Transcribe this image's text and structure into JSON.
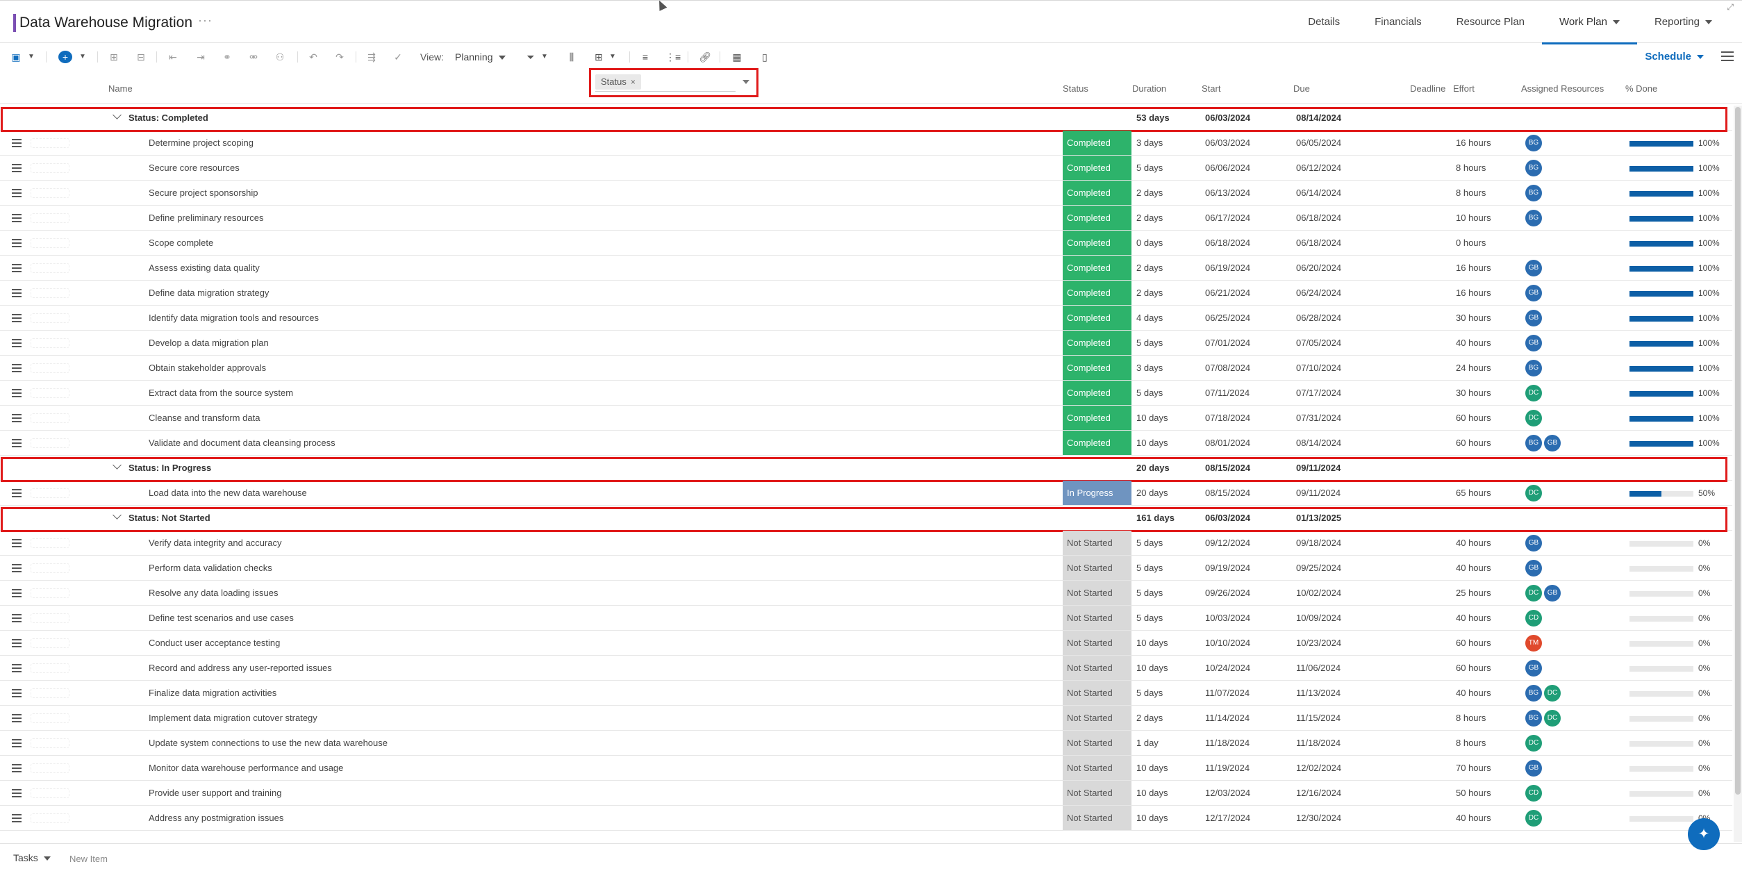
{
  "header": {
    "title": "Data Warehouse Migration",
    "more": "···",
    "tabs": [
      "Details",
      "Financials",
      "Resource Plan",
      "Work Plan",
      "Reporting"
    ],
    "active_tab": "Work Plan"
  },
  "toolbar": {
    "view_label": "View:",
    "view_value": "Planning",
    "schedule_label": "Schedule"
  },
  "groupby": {
    "chip": "Status",
    "remove": "×"
  },
  "columns": {
    "name": "Name",
    "status": "Status",
    "duration": "Duration",
    "start": "Start",
    "due": "Due",
    "deadline": "Deadline",
    "effort": "Effort",
    "assigned": "Assigned Resources",
    "done": "% Done"
  },
  "groups": [
    {
      "label": "Status: Completed",
      "duration": "53 days",
      "start": "06/03/2024",
      "due": "08/14/2024",
      "status_class": "completed",
      "rows": [
        {
          "name": "Determine project scoping",
          "status": "Completed",
          "duration": "3 days",
          "start": "06/03/2024",
          "due": "06/05/2024",
          "effort": "16 hours",
          "resources": [
            "BG"
          ],
          "pct": 100,
          "pct_label": "100%"
        },
        {
          "name": "Secure core resources",
          "status": "Completed",
          "duration": "5 days",
          "start": "06/06/2024",
          "due": "06/12/2024",
          "effort": "8 hours",
          "resources": [
            "BG"
          ],
          "pct": 100,
          "pct_label": "100%"
        },
        {
          "name": "Secure project sponsorship",
          "status": "Completed",
          "duration": "2 days",
          "start": "06/13/2024",
          "due": "06/14/2024",
          "effort": "8 hours",
          "resources": [
            "BG"
          ],
          "pct": 100,
          "pct_label": "100%"
        },
        {
          "name": "Define preliminary resources",
          "status": "Completed",
          "duration": "2 days",
          "start": "06/17/2024",
          "due": "06/18/2024",
          "effort": "10 hours",
          "resources": [
            "BG"
          ],
          "pct": 100,
          "pct_label": "100%"
        },
        {
          "name": "Scope complete",
          "status": "Completed",
          "duration": "0 days",
          "start": "06/18/2024",
          "due": "06/18/2024",
          "effort": "0 hours",
          "resources": [],
          "pct": 100,
          "pct_label": "100%"
        },
        {
          "name": "Assess existing data quality",
          "status": "Completed",
          "duration": "2 days",
          "start": "06/19/2024",
          "due": "06/20/2024",
          "effort": "16 hours",
          "resources": [
            "GB"
          ],
          "pct": 100,
          "pct_label": "100%"
        },
        {
          "name": "Define data migration strategy",
          "status": "Completed",
          "duration": "2 days",
          "start": "06/21/2024",
          "due": "06/24/2024",
          "effort": "16 hours",
          "resources": [
            "GB"
          ],
          "pct": 100,
          "pct_label": "100%"
        },
        {
          "name": "Identify data migration tools and resources",
          "status": "Completed",
          "duration": "4 days",
          "start": "06/25/2024",
          "due": "06/28/2024",
          "effort": "30 hours",
          "resources": [
            "GB"
          ],
          "pct": 100,
          "pct_label": "100%"
        },
        {
          "name": "Develop a data migration plan",
          "status": "Completed",
          "duration": "5 days",
          "start": "07/01/2024",
          "due": "07/05/2024",
          "effort": "40 hours",
          "resources": [
            "GB"
          ],
          "pct": 100,
          "pct_label": "100%"
        },
        {
          "name": "Obtain stakeholder approvals",
          "status": "Completed",
          "duration": "3 days",
          "start": "07/08/2024",
          "due": "07/10/2024",
          "effort": "24 hours",
          "resources": [
            "BG"
          ],
          "pct": 100,
          "pct_label": "100%"
        },
        {
          "name": "Extract data from the source system",
          "status": "Completed",
          "duration": "5 days",
          "start": "07/11/2024",
          "due": "07/17/2024",
          "effort": "30 hours",
          "resources": [
            "DC"
          ],
          "pct": 100,
          "pct_label": "100%"
        },
        {
          "name": "Cleanse and transform data",
          "status": "Completed",
          "duration": "10 days",
          "start": "07/18/2024",
          "due": "07/31/2024",
          "effort": "60 hours",
          "resources": [
            "DC"
          ],
          "pct": 100,
          "pct_label": "100%"
        },
        {
          "name": "Validate and document data cleansing process",
          "status": "Completed",
          "duration": "10 days",
          "start": "08/01/2024",
          "due": "08/14/2024",
          "effort": "60 hours",
          "resources": [
            "BG",
            "GB"
          ],
          "pct": 100,
          "pct_label": "100%"
        }
      ]
    },
    {
      "label": "Status: In Progress",
      "duration": "20 days",
      "start": "08/15/2024",
      "due": "09/11/2024",
      "status_class": "inprogress",
      "rows": [
        {
          "name": "Load data into the new data warehouse",
          "status": "In Progress",
          "duration": "20 days",
          "start": "08/15/2024",
          "due": "09/11/2024",
          "effort": "65 hours",
          "resources": [
            "DC"
          ],
          "pct": 50,
          "pct_label": "50%"
        }
      ]
    },
    {
      "label": "Status: Not Started",
      "duration": "161 days",
      "start": "06/03/2024",
      "due": "01/13/2025",
      "status_class": "notstarted",
      "rows": [
        {
          "name": "Verify data integrity and accuracy",
          "status": "Not Started",
          "duration": "5 days",
          "start": "09/12/2024",
          "due": "09/18/2024",
          "effort": "40 hours",
          "resources": [
            "GB"
          ],
          "pct": 0,
          "pct_label": "0%"
        },
        {
          "name": "Perform data validation checks",
          "status": "Not Started",
          "duration": "5 days",
          "start": "09/19/2024",
          "due": "09/25/2024",
          "effort": "40 hours",
          "resources": [
            "GB"
          ],
          "pct": 0,
          "pct_label": "0%"
        },
        {
          "name": "Resolve any data loading issues",
          "status": "Not Started",
          "duration": "5 days",
          "start": "09/26/2024",
          "due": "10/02/2024",
          "effort": "25 hours",
          "resources": [
            "DC",
            "GB"
          ],
          "pct": 0,
          "pct_label": "0%"
        },
        {
          "name": "Define test scenarios and use cases",
          "status": "Not Started",
          "duration": "5 days",
          "start": "10/03/2024",
          "due": "10/09/2024",
          "effort": "40 hours",
          "resources": [
            "CD"
          ],
          "pct": 0,
          "pct_label": "0%"
        },
        {
          "name": "Conduct user acceptance testing",
          "status": "Not Started",
          "duration": "10 days",
          "start": "10/10/2024",
          "due": "10/23/2024",
          "effort": "60 hours",
          "resources": [
            "TM"
          ],
          "pct": 0,
          "pct_label": "0%"
        },
        {
          "name": "Record and address any user-reported issues",
          "status": "Not Started",
          "duration": "10 days",
          "start": "10/24/2024",
          "due": "11/06/2024",
          "effort": "60 hours",
          "resources": [
            "GB"
          ],
          "pct": 0,
          "pct_label": "0%"
        },
        {
          "name": "Finalize data migration activities",
          "status": "Not Started",
          "duration": "5 days",
          "start": "11/07/2024",
          "due": "11/13/2024",
          "effort": "40 hours",
          "resources": [
            "BG",
            "DC"
          ],
          "pct": 0,
          "pct_label": "0%"
        },
        {
          "name": "Implement data migration cutover strategy",
          "status": "Not Started",
          "duration": "2 days",
          "start": "11/14/2024",
          "due": "11/15/2024",
          "effort": "8 hours",
          "resources": [
            "BG",
            "DC"
          ],
          "pct": 0,
          "pct_label": "0%"
        },
        {
          "name": "Update system connections to use the new data warehouse",
          "status": "Not Started",
          "duration": "1 day",
          "start": "11/18/2024",
          "due": "11/18/2024",
          "effort": "8 hours",
          "resources": [
            "DC"
          ],
          "pct": 0,
          "pct_label": "0%"
        },
        {
          "name": "Monitor data warehouse performance and usage",
          "status": "Not Started",
          "duration": "10 days",
          "start": "11/19/2024",
          "due": "12/02/2024",
          "effort": "70 hours",
          "resources": [
            "GB"
          ],
          "pct": 0,
          "pct_label": "0%"
        },
        {
          "name": "Provide user support and training",
          "status": "Not Started",
          "duration": "10 days",
          "start": "12/03/2024",
          "due": "12/16/2024",
          "effort": "50 hours",
          "resources": [
            "CD"
          ],
          "pct": 0,
          "pct_label": "0%"
        },
        {
          "name": "Address any postmigration issues",
          "status": "Not Started",
          "duration": "10 days",
          "start": "12/17/2024",
          "due": "12/30/2024",
          "effort": "40 hours",
          "resources": [
            "DC"
          ],
          "pct": 0,
          "pct_label": "0%"
        }
      ]
    }
  ],
  "avatar_colors": {
    "BG": "#2b6cb0",
    "GB": "#2b6cb0",
    "DC": "#1f9e77",
    "CD": "#1f9e77",
    "TM": "#e0492c"
  },
  "footer": {
    "tasks_label": "Tasks",
    "new_item": "New Item"
  },
  "colors": {
    "accent": "#0f6cbd",
    "highlight": "#e01b1b"
  }
}
